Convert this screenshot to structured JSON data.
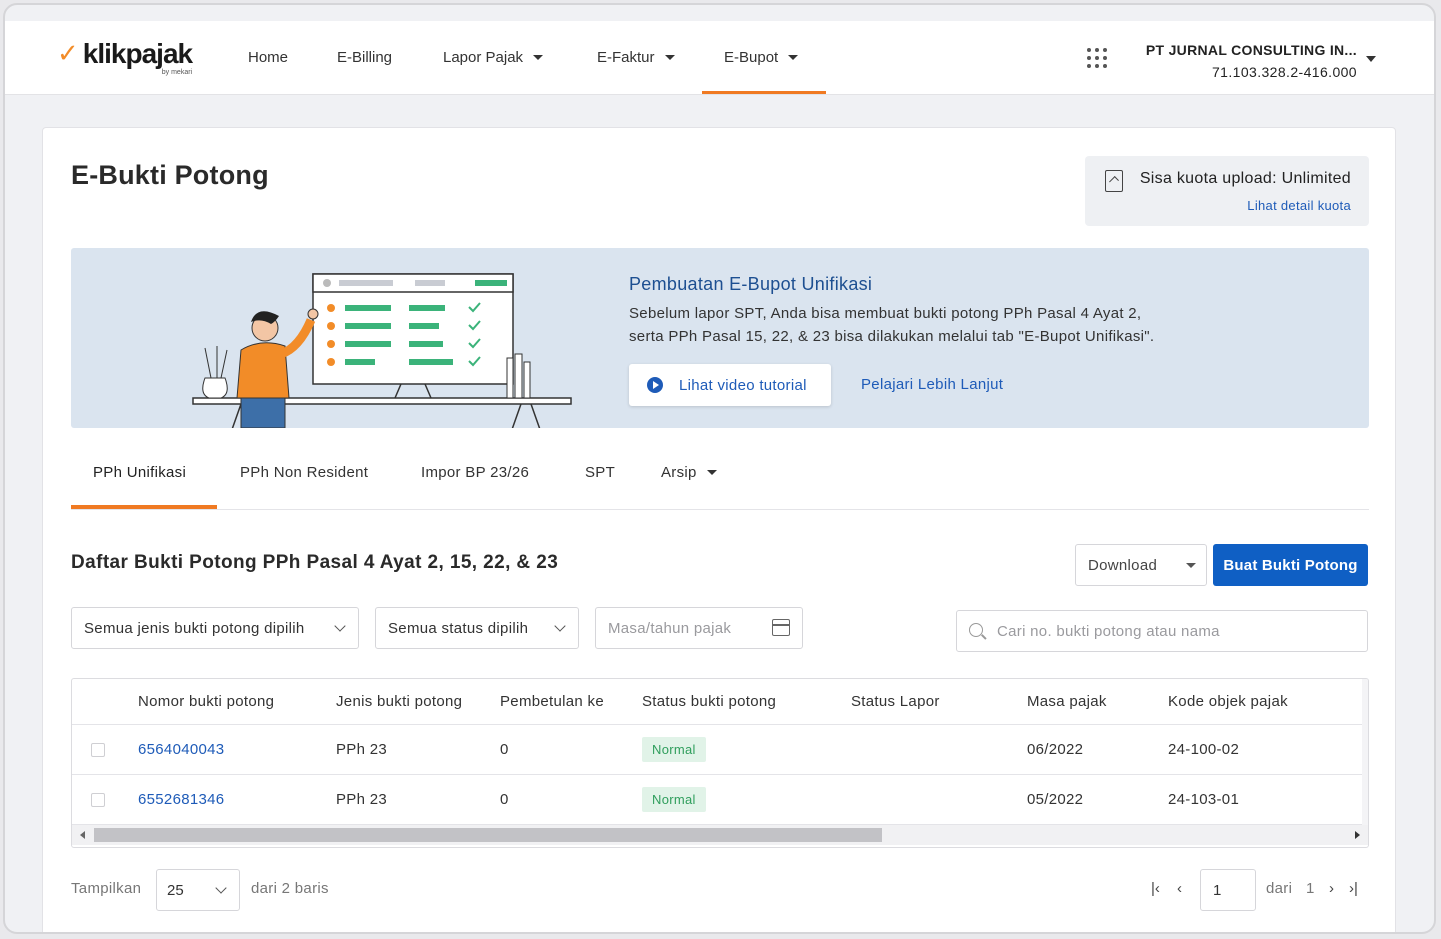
{
  "brand": {
    "name": "klikpajak",
    "byline": "by mekari"
  },
  "nav": {
    "items": [
      {
        "label": "Home"
      },
      {
        "label": "E-Billing"
      },
      {
        "label": "Lapor Pajak"
      },
      {
        "label": "E-Faktur"
      },
      {
        "label": "E-Bupot"
      }
    ],
    "active": "E-Bupot",
    "company_name": "PT JURNAL CONSULTING IN...",
    "npwp": "71.103.328.2-416.000"
  },
  "page": {
    "title": "E-Bukti Potong"
  },
  "quota": {
    "text": "Sisa kuota upload: Unlimited",
    "link": "Lihat detail kuota"
  },
  "banner": {
    "title": "Pembuatan E-Bupot Unifikasi",
    "desc_line1": "Sebelum lapor SPT, Anda bisa membuat bukti potong PPh Pasal 4 Ayat 2,",
    "desc_line2": "serta PPh Pasal 15, 22, & 23 bisa dilakukan melalui tab \"E-Bupot Unifikasi\".",
    "video_button": "Lihat video tutorial",
    "learn_more": "Pelajari Lebih Lanjut"
  },
  "tabs": [
    {
      "label": "PPh Unifikasi"
    },
    {
      "label": "PPh Non Resident"
    },
    {
      "label": "Impor BP 23/26"
    },
    {
      "label": "SPT"
    },
    {
      "label": "Arsip"
    }
  ],
  "list": {
    "title": "Daftar Bukti Potong PPh Pasal 4 Ayat 2, 15, 22, & 23",
    "download_label": "Download",
    "create_label": "Buat Bukti Potong"
  },
  "filters": {
    "type": "Semua jenis bukti potong dipilih",
    "status": "Semua status dipilih",
    "period_placeholder": "Masa/tahun pajak",
    "search_placeholder": "Cari no. bukti potong atau nama"
  },
  "table": {
    "headers": [
      "Nomor bukti potong",
      "Jenis bukti potong",
      "Pembetulan ke",
      "Status bukti potong",
      "Status Lapor",
      "Masa pajak",
      "Kode objek pajak"
    ],
    "rows": [
      {
        "nomor": "6564040043",
        "jenis": "PPh 23",
        "pembetulan": "0",
        "status": "Normal",
        "status_lapor": "",
        "masa": "06/2022",
        "kode": "24-100-02"
      },
      {
        "nomor": "6552681346",
        "jenis": "PPh 23",
        "pembetulan": "0",
        "status": "Normal",
        "status_lapor": "",
        "masa": "05/2022",
        "kode": "24-103-01"
      }
    ]
  },
  "pagination": {
    "show_label": "Tampilkan",
    "page_size": "25",
    "total_label": "dari 2 baris",
    "current_page": "1",
    "of_label": "dari",
    "total_pages": "1"
  },
  "colors": {
    "accent": "#f07a22",
    "primary": "#0f5fc4",
    "link": "#1e5bb8",
    "badge_bg": "#e1f3e8",
    "badge_text": "#2f9e5c"
  }
}
